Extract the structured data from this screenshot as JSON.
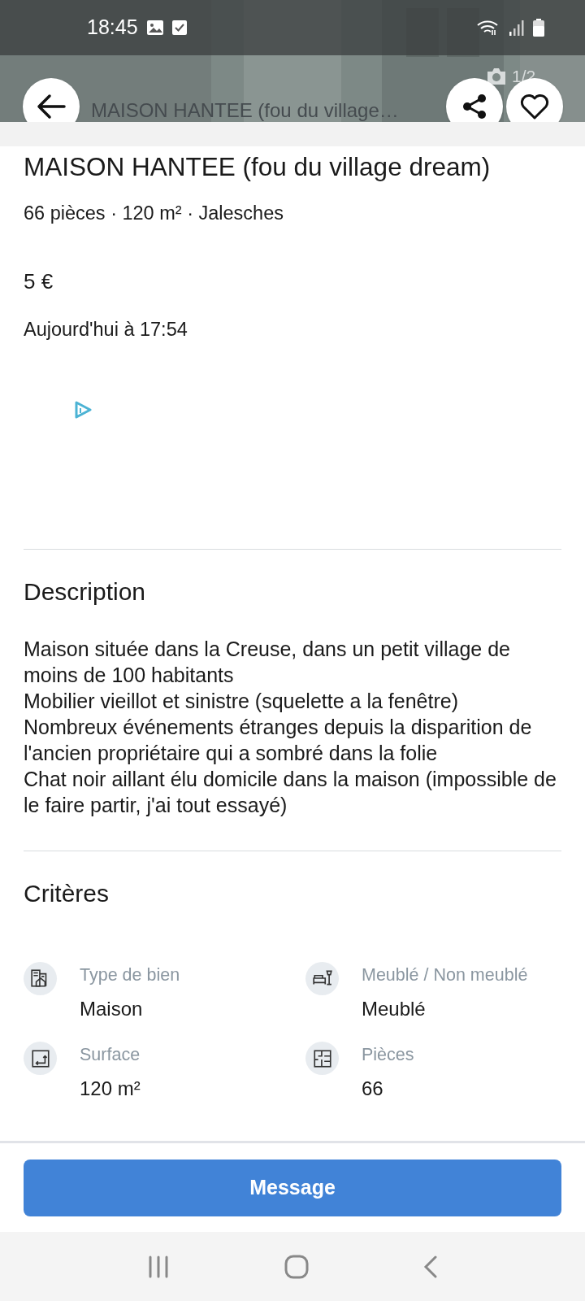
{
  "status_bar": {
    "time": "18:45"
  },
  "header": {
    "title": "MAISON HANTEE (fou du village…",
    "photo_counter": "1/2"
  },
  "listing": {
    "title": "MAISON HANTEE (fou du village dream)",
    "subtitle": "66 pièces · 120 m² · Jalesches",
    "price": "5 €",
    "date": "Aujourd'hui à 17:54"
  },
  "description": {
    "heading": "Description",
    "paragraphs": [
      "Maison située dans la Creuse, dans un petit village de moins de 100 habitants",
      "Mobilier vieillot et sinistre (squelette a la fenêtre)",
      "Nombreux événements étranges depuis la disparition de l'ancien propriétaire qui a sombré dans la folie",
      "Chat noir aillant élu domicile dans la maison (impossible de le faire partir, j'ai tout essayé)"
    ]
  },
  "criteria": {
    "heading": "Critères",
    "items": [
      {
        "kind": "property_type",
        "label": "Type de bien",
        "value": "Maison"
      },
      {
        "kind": "furnished",
        "label": "Meublé / Non meublé",
        "value": "Meublé"
      },
      {
        "kind": "surface",
        "label": "Surface",
        "value": "120 m²"
      },
      {
        "kind": "rooms",
        "label": "Pièces",
        "value": "66"
      }
    ]
  },
  "action": {
    "label": "Message"
  }
}
